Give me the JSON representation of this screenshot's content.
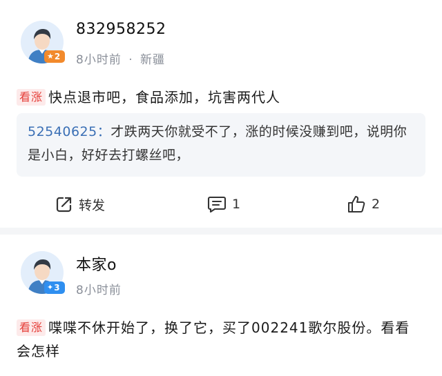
{
  "posts": [
    {
      "username": "832958252",
      "level": "2",
      "time": "8小时前",
      "separator": "·",
      "location": "新疆",
      "tag": "看涨",
      "content": "快点退市吧，食品添加，坑害两代人",
      "quote": {
        "user": "52540625",
        "colon": "：",
        "text": "才跌两天你就受不了，涨的时候没赚到吧，说明你是小白，好好去打螺丝吧，"
      },
      "actions": {
        "share_label": "转发",
        "comment_count": "1",
        "like_count": "2"
      },
      "colors": {
        "badge": "#f28a2c"
      }
    },
    {
      "username": "本家o",
      "level": "3",
      "time": "8小时前",
      "tag": "看涨",
      "content": "喋喋不休开始了，换了它，买了002241歌尔股份。看看会怎样",
      "colors": {
        "badge": "#2f8ff0"
      }
    }
  ],
  "icons": {
    "share": "share-icon",
    "comment": "comment-icon",
    "like": "thumbs-up-icon"
  }
}
